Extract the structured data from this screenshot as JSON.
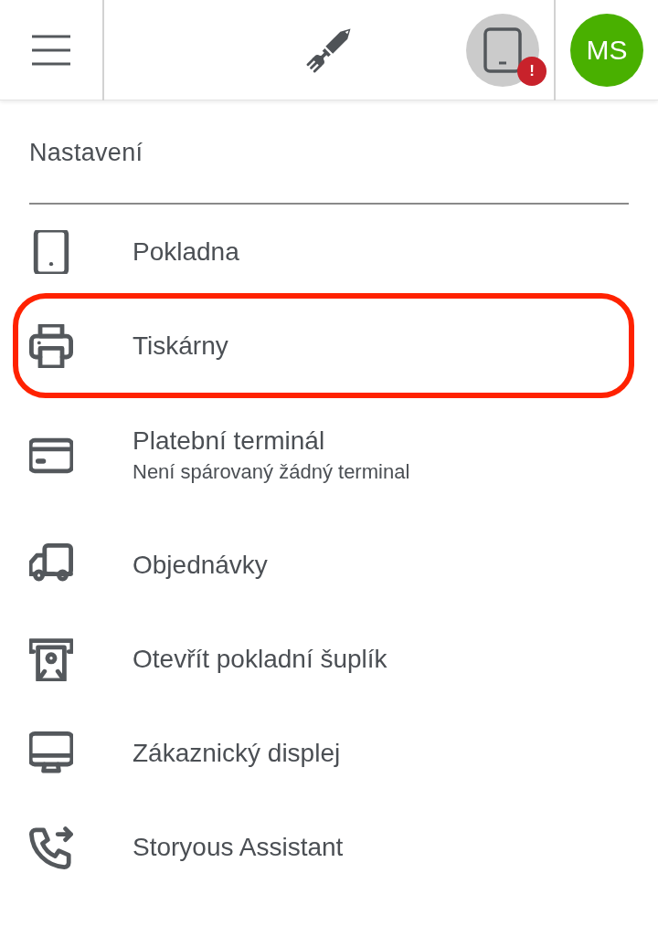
{
  "header": {
    "device_badge": "!",
    "avatar_initials": "MS"
  },
  "settings": {
    "title": "Nastavení",
    "items": [
      {
        "label": "Pokladna",
        "highlighted": false
      },
      {
        "label": "Tiskárny",
        "highlighted": true
      },
      {
        "label": "Platební terminál",
        "subtitle": "Není spárovaný žádný terminal",
        "highlighted": false
      },
      {
        "label": "Objednávky",
        "highlighted": false
      },
      {
        "label": "Otevřít pokladní šuplík",
        "highlighted": false
      },
      {
        "label": "Zákaznický displej",
        "highlighted": false
      },
      {
        "label": "Storyous Assistant",
        "highlighted": false
      }
    ]
  }
}
